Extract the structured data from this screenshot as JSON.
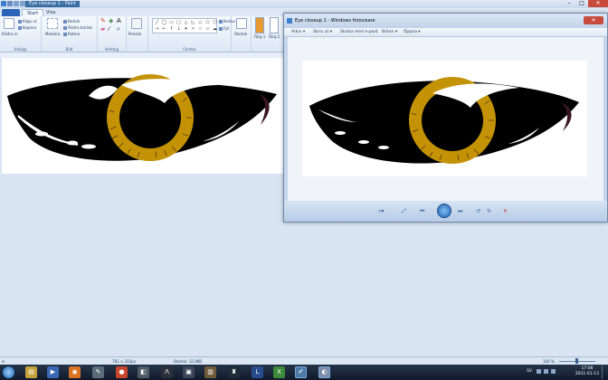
{
  "paint": {
    "title": "Eye closeup 1 - Paint",
    "tabs": [
      "Start",
      "Visa"
    ],
    "groups": {
      "clipboard": {
        "label": "Urklipp",
        "paste": "Klistra in",
        "cut": "Klipp ut",
        "copy": "Kopiera"
      },
      "image": {
        "label": "Bild",
        "select": "Markera",
        "crop": "Beskär",
        "resize": "Ändra storlek",
        "rotate": "Rotera"
      },
      "tools": {
        "label": "Verktyg"
      },
      "brushes": {
        "label": "Penslar"
      },
      "shapes": {
        "label": "Former",
        "outline": "Kontur",
        "fill": "Fyll"
      },
      "size": {
        "label": "Storlek"
      },
      "color1": {
        "label": "Färg 1",
        "value": "#000000"
      },
      "color2": {
        "label": "Färg 2",
        "value": "#ffffff"
      }
    },
    "palette": [
      "#000000",
      "#7f7f7f",
      "#880015",
      "#ed1c24",
      "#ff7f27",
      "#fff200",
      "#22b14c",
      "#00a2e8",
      "#3f48cc",
      "#a349a4",
      "#ffffff",
      "#c3c3c3",
      "#b97a57",
      "#ffaec9",
      "#ffc90e",
      "#efe4b0",
      "#b5e61d",
      "#99d9ea",
      "#7092be",
      "#c8bfe7"
    ],
    "shape_glyphs": [
      "╱",
      "◯",
      "▭",
      "▢",
      "△",
      "◺",
      "◇",
      "⬠",
      "⬡",
      "→",
      "←",
      "↑",
      "↓",
      "✦",
      "✧",
      "☆",
      "▱",
      "☁"
    ]
  },
  "viewer": {
    "title": "Eye closeup 1 - Windows fotovisare",
    "menu": [
      "Arkiv ▾",
      "Skriv ut ▾",
      "Skicka med e-post",
      "Bränn ▾",
      "Öppna ▾"
    ],
    "controls": {
      "zoom": "⌕▾",
      "fit": "⤢",
      "prev": "⏮",
      "next": "⏭",
      "rotate_ccw": "↺",
      "rotate_cw": "↻",
      "delete": "✕"
    }
  },
  "statusbar": {
    "dimensions": "781 × 315px",
    "size": "Storlek: 12,9KB",
    "zoom": "100 %"
  },
  "taskbar": {
    "language": "SV",
    "time": "17:08",
    "date": "2011-01-13"
  },
  "eye_colors": {
    "iris": "#c49206",
    "sclera": "#000000",
    "pupil": "#000000",
    "highlight": "#ffffff",
    "rim": "#3a1522"
  }
}
